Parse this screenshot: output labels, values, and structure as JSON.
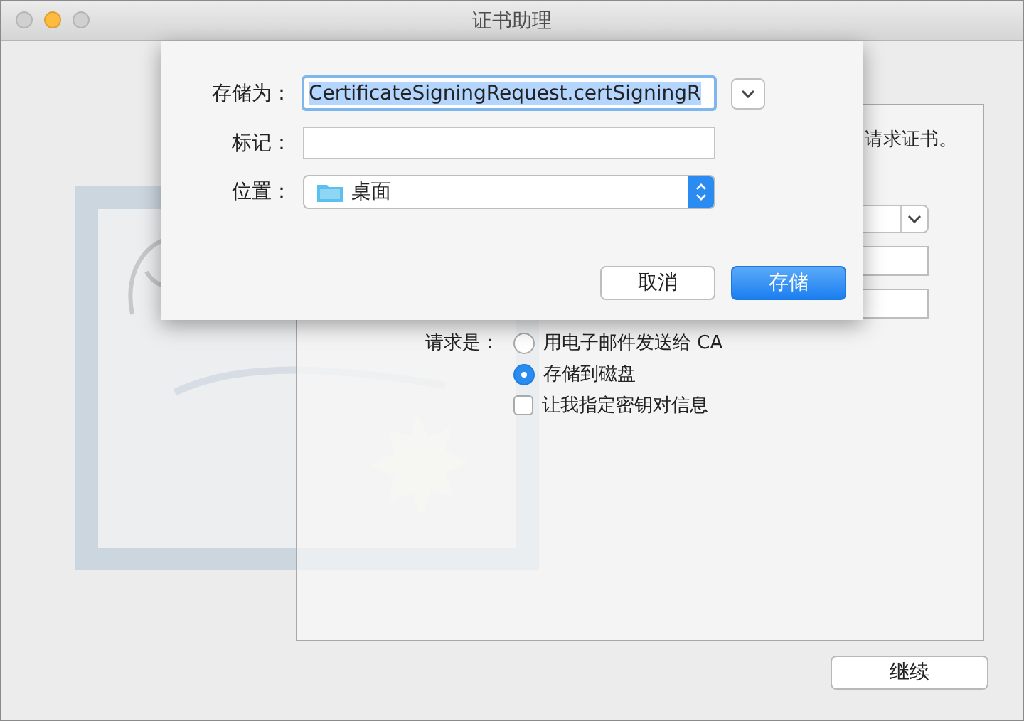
{
  "window": {
    "title": "证书助理"
  },
  "save_sheet": {
    "save_as": {
      "label": "存储为：",
      "value": "CertificateSigningRequest.certSigningR",
      "text_selected": true
    },
    "tags": {
      "label": "标记："
    },
    "location": {
      "label": "位置：",
      "value": "桌面"
    },
    "buttons": [
      {
        "label": "取消",
        "default": false
      },
      {
        "label": "存储",
        "default": true
      }
    ]
  },
  "assistant": {
    "intro_text": "请求证书。",
    "request_label": "请求是：",
    "options": [
      {
        "kind": "radio",
        "label": "用电子邮件发送给 CA",
        "selected": false
      },
      {
        "kind": "radio",
        "label": "存储到磁盘",
        "selected": true
      },
      {
        "kind": "checkbox",
        "label": "让我指定密钥对信息",
        "checked": false
      }
    ]
  },
  "continue_button": "继续"
}
